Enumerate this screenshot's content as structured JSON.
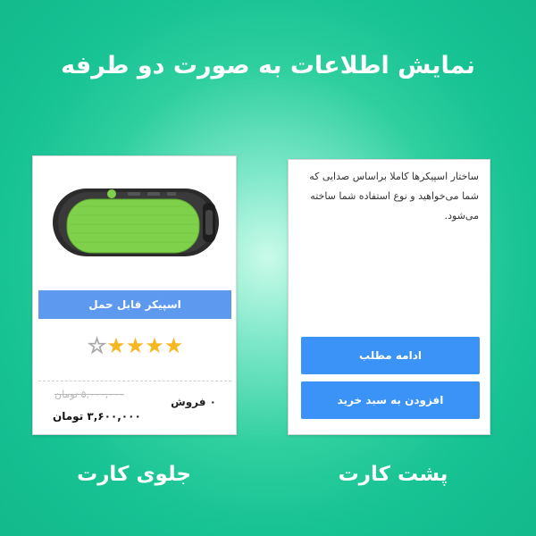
{
  "header": {
    "title": "نمایش اطلاعات به صورت دو طرفه"
  },
  "captions": {
    "front": "جلوی کارت",
    "back": "پشت کارت"
  },
  "front_card": {
    "image_icon": "speaker-product-image",
    "title": "اسپیکر قابل حمل",
    "rating": {
      "stars": "★★★★",
      "empty_star": "☆",
      "value": 4,
      "max": 5
    },
    "sales": "۰ فروش",
    "old_price": "۵,۰۰۰,۰۰۰ تومان",
    "new_price": "۳,۶۰۰,۰۰۰ تومان"
  },
  "back_card": {
    "description": "ساختار اسپیکرها کاملا براساس صدایی که شما می‌خواهید و نوع استفاده شما ساخته می‌شود.",
    "continue_label": "ادامه مطلب",
    "add_to_cart_label": "افزودن به سبد خرید"
  },
  "colors": {
    "background": "#17c293",
    "title_bar": "#5e99f0",
    "button": "#3b93f7",
    "star": "#f8b61f",
    "speaker_grille": "#7fd04a"
  }
}
